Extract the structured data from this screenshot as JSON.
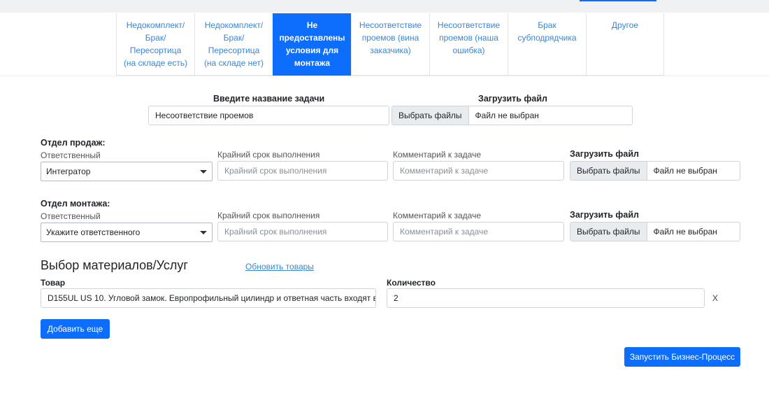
{
  "tabs": [
    {
      "label": "Недокомплект/\nБрак/\nПересортица\n(на складе есть)"
    },
    {
      "label": "Недокомплект/\nБрак/\nПересортица\n(на складе нет)"
    },
    {
      "label": "Не\nпредоставлены\nусловия для\nмонтажа"
    },
    {
      "label": "Несоответствие\nпроемов (вина\nзаказчика)"
    },
    {
      "label": "Несоответствие\nпроемов (наша\nошибка)"
    },
    {
      "label": "Брак\nсубподрядчика"
    },
    {
      "label": "Другое"
    }
  ],
  "active_tab": 2,
  "task": {
    "name_label": "Введите название задачи",
    "name_value": "Несоответствие проемов",
    "upload_label": "Загрузить файл",
    "file_button": "Выбрать файлы",
    "file_status": "Файл не выбран"
  },
  "sales": {
    "title": "Отдел продаж:",
    "responsible_label": "Ответственный",
    "responsible_value": "Интегратор",
    "deadline_label": "Крайний срок выполнения",
    "deadline_placeholder": "Крайний срок выполнения",
    "comment_label": "Комментарий к задаче",
    "comment_placeholder": "Комментарий к задаче",
    "upload_label": "Загрузить файл",
    "file_button": "Выбрать файлы",
    "file_status": "Файл не выбран"
  },
  "install": {
    "title": "Отдел монтажа:",
    "responsible_label": "Ответственный",
    "responsible_value": "Укажите ответственного",
    "deadline_label": "Крайний срок выполнения",
    "deadline_placeholder": "Крайний срок выполнения",
    "comment_label": "Комментарий к задаче",
    "comment_placeholder": "Комментарий к задаче",
    "upload_label": "Загрузить файл",
    "file_button": "Выбрать файлы",
    "file_status": "Файл не выбран"
  },
  "materials": {
    "title": "Выбор материалов/Услуг",
    "refresh_link": "Обновить товары",
    "product_label": "Товар",
    "product_value": "D155UL US 10. Угловой замок. Европрофильный цилиндр и ответная часть входят в",
    "quantity_label": "Количество",
    "quantity_value": "2",
    "remove_label": "X",
    "add_button": "Добавить еще"
  },
  "submit_button": "Запустить Бизнес-Процесс",
  "colors": {
    "accent": "#0d6efd",
    "link": "#3a86d6"
  }
}
